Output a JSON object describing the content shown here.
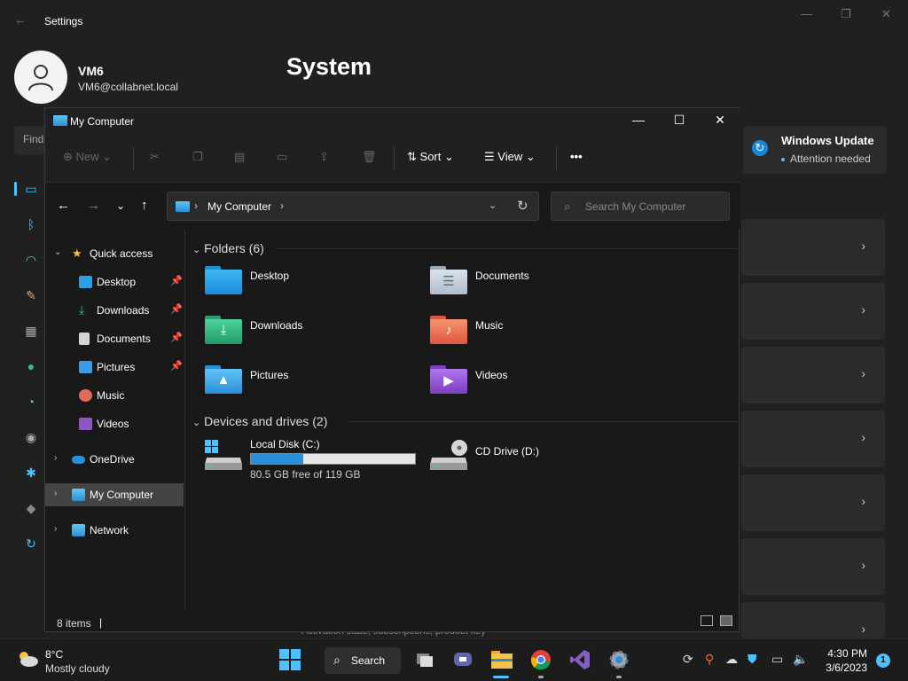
{
  "settings": {
    "window_title": "Settings",
    "user_name": "VM6",
    "user_email": "VM6@collabnet.local",
    "page_title": "System",
    "find_placeholder": "Find",
    "windows_update": {
      "title": "Windows Update",
      "status": "Attention needed"
    },
    "activation_text": "Activation state, subscriptions, product key"
  },
  "explorer": {
    "title": "My Computer",
    "toolbar": {
      "new": "New",
      "sort": "Sort",
      "view": "View",
      "more": "•••"
    },
    "address": {
      "path": "My Computer"
    },
    "search_placeholder": "Search My Computer",
    "sidebar": {
      "quick_access": "Quick access",
      "items": [
        {
          "label": "Desktop",
          "pinned": true
        },
        {
          "label": "Downloads",
          "pinned": true
        },
        {
          "label": "Documents",
          "pinned": true
        },
        {
          "label": "Pictures",
          "pinned": true
        },
        {
          "label": "Music",
          "pinned": false
        },
        {
          "label": "Videos",
          "pinned": false
        }
      ],
      "onedrive": "OneDrive",
      "my_computer": "My Computer",
      "network": "Network"
    },
    "folders_header": "Folders (6)",
    "folders": [
      "Desktop",
      "Documents",
      "Downloads",
      "Music",
      "Pictures",
      "Videos"
    ],
    "drives_header": "Devices and drives (2)",
    "drives": [
      {
        "name": "Local Disk (C:)",
        "free_text": "80.5 GB free of 119 GB",
        "used_fraction": 0.32
      },
      {
        "name": "CD Drive (D:)"
      }
    ],
    "status": {
      "item_count": "8 items"
    }
  },
  "taskbar": {
    "temperature": "8°C",
    "condition": "Mostly cloudy",
    "search_label": "Search",
    "time": "4:30 PM",
    "date": "3/6/2023",
    "notification_count": "1"
  },
  "colors": {
    "accent": "#4cc2ff",
    "drive_fill": "#2a8fd6",
    "selection": "#444444"
  }
}
